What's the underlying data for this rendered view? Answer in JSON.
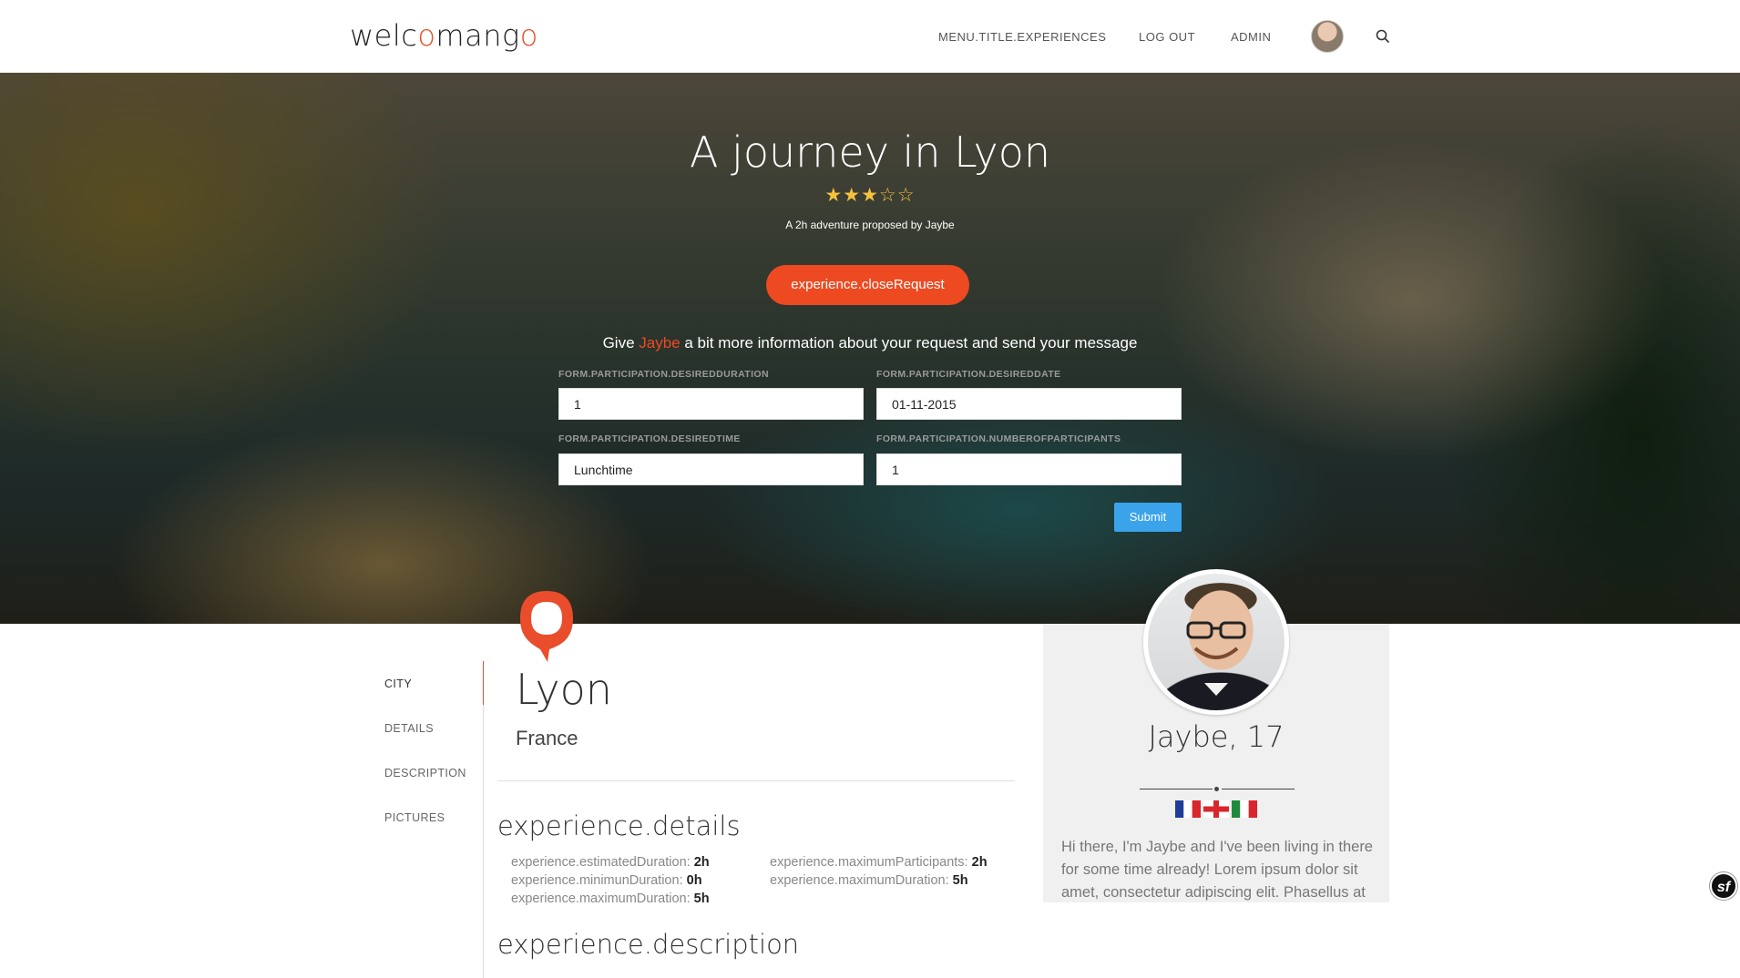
{
  "header": {
    "logo_prefix": "welc",
    "logo_o1": "o",
    "logo_middle": "mang",
    "logo_o2": "o",
    "nav": [
      "MENU.TITLE.EXPERIENCES",
      "LOG OUT",
      "ADMIN"
    ],
    "search_icon": "search-icon"
  },
  "hero": {
    "title": "A journey in Lyon",
    "rating": {
      "value": 3,
      "max": 5,
      "stars": "★★★☆☆"
    },
    "subtitle": "A 2h adventure proposed by Jaybe",
    "close_button": "experience.closeRequest",
    "give_prefix": "Give ",
    "give_host": "Jaybe",
    "give_suffix": " a bit more information about your request and send your message"
  },
  "form": {
    "duration_label": "FORM.PARTICIPATION.DESIREDDURATION",
    "duration_value": "1",
    "date_label": "FORM.PARTICIPATION.DESIREDDATE",
    "date_value": "01-11-2015",
    "time_label": "FORM.PARTICIPATION.DESIREDTIME",
    "time_value": "Lunchtime",
    "participants_label": "FORM.PARTICIPATION.NUMBEROFPARTICIPANTS",
    "participants_value": "1",
    "submit": "Submit"
  },
  "sidebar": {
    "items": [
      "CITY",
      "DETAILS",
      "DESCRIPTION",
      "PICTURES"
    ],
    "active": "CITY"
  },
  "city": {
    "name": "Lyon",
    "country": "France"
  },
  "details": {
    "heading": "experience.details",
    "left": [
      {
        "label": "experience.estimatedDuration:",
        "value": "2h"
      },
      {
        "label": "experience.minimunDuration:",
        "value": "0h"
      },
      {
        "label": "experience.maximumDuration:",
        "value": "5h"
      }
    ],
    "right": [
      {
        "label": "experience.maximumParticipants:",
        "value": "2h"
      },
      {
        "label": "experience.maximumDuration:",
        "value": "5h"
      }
    ]
  },
  "description": {
    "heading": "experience.description"
  },
  "profile": {
    "name": "Jaybe, 17",
    "flags": [
      "flag-france-icon",
      "flag-england-icon",
      "flag-italy-icon"
    ],
    "bio": "Hi there, I'm Jaybe and I've been living in there for some time already! Lorem ipsum dolor sit amet, consectetur adipiscing elit. Phasellus at"
  },
  "colors": {
    "accent": "#ee4a22",
    "submit": "#3aa3ea",
    "star": "#f5c23e"
  },
  "symfony_badge": "sf"
}
